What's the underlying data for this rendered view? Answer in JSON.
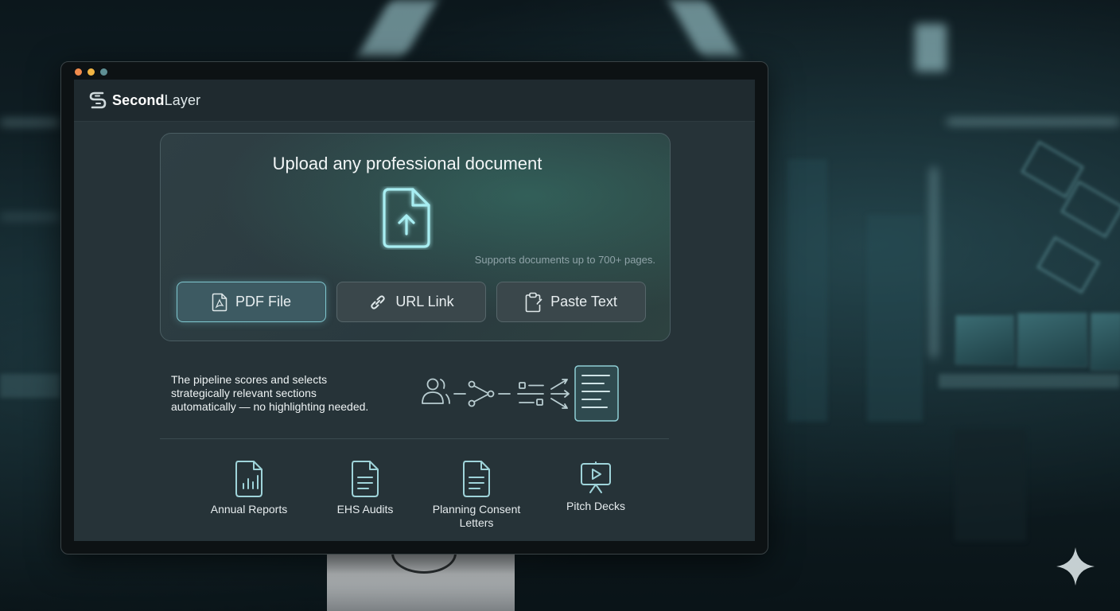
{
  "window": {
    "dot_colors": [
      "#f28b4c",
      "#f2b544",
      "#5f8f94"
    ]
  },
  "app": {
    "brand_bold": "Second",
    "brand_light": "Layer"
  },
  "upload": {
    "title": "Upload any professional document",
    "support_text": "Supports documents up to 700+ pages.",
    "buttons": [
      {
        "label": "PDF File",
        "icon": "pdf-icon",
        "selected": true
      },
      {
        "label": "URL Link",
        "icon": "link-icon",
        "selected": false
      },
      {
        "label": "Paste Text",
        "icon": "clipboard-icon",
        "selected": false
      }
    ]
  },
  "pipeline": {
    "lines": [
      "The pipeline scores and selects",
      "strategically relevant sections",
      "automatically — no highlighting needed."
    ]
  },
  "doc_types": [
    {
      "label": "Annual Reports",
      "icon": "bar-chart-doc-icon"
    },
    {
      "label": "EHS Audits",
      "icon": "document-icon"
    },
    {
      "label": "Planning Consent Letters",
      "icon": "document-icon"
    },
    {
      "label": "Pitch Decks",
      "icon": "presentation-icon"
    }
  ],
  "colors": {
    "accent": "#7fc7cf",
    "panel": "#263338",
    "text": "#eef3f4"
  }
}
